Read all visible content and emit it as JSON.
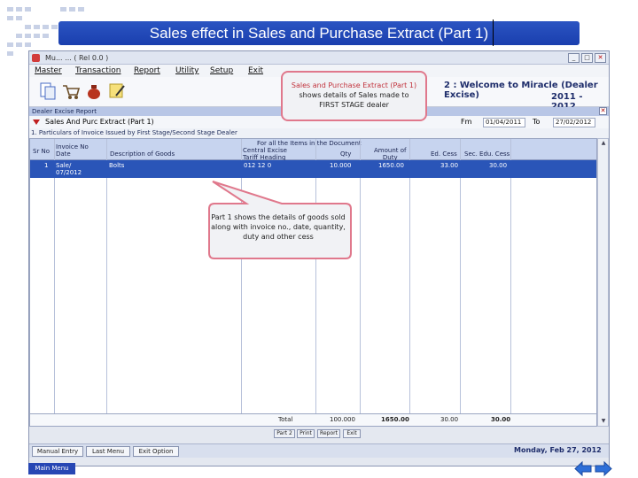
{
  "slide": {
    "title": "Sales effect in Sales and Purchase Extract (Part 1)",
    "main_menu_label": "Main Menu"
  },
  "window": {
    "title": "Mu... ... ( Rel 0.0 )",
    "close_glyph": "✕",
    "min_glyph": "_",
    "max_glyph": "□"
  },
  "menu": [
    "Master",
    "Transaction",
    "Report",
    "Utility",
    "Setup",
    "Exit"
  ],
  "toolbar": {
    "welcome_text": "2 : Welcome to Miracle (Dealer Excise)",
    "year": "2011 - 2012"
  },
  "subbar": {
    "label": "Dealer Excise Report",
    "close_glyph": "✕"
  },
  "form": {
    "title": "Sales And Purc Extract (Part 1)",
    "from_label": "Fm",
    "from_value": "01/04/2011",
    "to_label": "To",
    "to_value": "27/02/2012",
    "section": "1. Particulars of Invoice Issued by First Stage/Second Stage Dealer"
  },
  "grid": {
    "group_header": "For all the Items in the Document",
    "headers": {
      "srno": "Sr No",
      "invoice": "Invoice No\nDate",
      "desc": "Description of Goods",
      "tariff": "Central Excise\nTariff Heading",
      "qty": "Qty",
      "amount": "Amount of\nDuty",
      "ed": "Ed. Cess",
      "sec": "Sec. Edu. Cess"
    },
    "rows": [
      {
        "srno": "1",
        "invoice": "Sale/\n07/2012",
        "desc": "Bolts",
        "tariff": "012 12 0",
        "qty": "10.000",
        "amount": "1650.00",
        "ed": "33.00",
        "sec": "30.00"
      }
    ],
    "total": {
      "label": "Total",
      "qty": "100.000",
      "amount": "1650.00",
      "ed": "30.00",
      "sec": "30.00"
    }
  },
  "buttons": [
    "Part 2",
    "Print",
    "Report",
    "Exit"
  ],
  "bottom": {
    "buttons": [
      "Manual Entry",
      "Last Menu",
      "Exit Option"
    ],
    "date": "Monday, Feb 27, 2012"
  },
  "callouts": {
    "c1_title": "Sales and Purchase Extract (Part 1)",
    "c1_line1": "shows details of Sales made to",
    "c1_line2": "FIRST STAGE dealer",
    "c2_text": "Part 1 shows the details of goods sold along with invoice no., date, quantity, duty and other cess"
  },
  "colors": {
    "banner": "#2b54c2",
    "highlight_row": "#2a55b8",
    "callout_border": "#e0788c"
  }
}
